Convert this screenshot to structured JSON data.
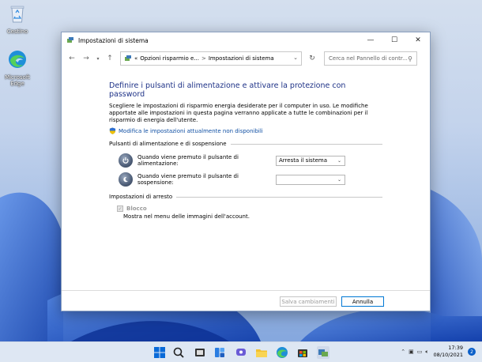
{
  "desktop": {
    "icons": [
      {
        "label": "Cestino"
      },
      {
        "label": "Microsoft Edge"
      }
    ]
  },
  "window": {
    "title": "Impostazioni di sistema",
    "breadcrumb": {
      "prefix": "«",
      "parent": "Opzioni risparmio e...",
      "separator": ">",
      "current": "Impostazioni di sistema"
    },
    "search_placeholder": "Cerca nel Pannello di contr...",
    "heading": "Definire i pulsanti di alimentazione e attivare la protezione con password",
    "description": "Scegliere le impostazioni di risparmio energia desiderate per il computer in uso. Le modifiche apportate alle impostazioni in questa pagina verranno applicate a tutte le combinazioni per il risparmio di energia dell'utente.",
    "change_link": "Modifica le impostazioni attualmente non disponibili",
    "power_group": {
      "title": "Pulsanti di alimentazione e di sospensione",
      "rows": [
        {
          "label": "Quando viene premuto il pulsante di alimentazione:",
          "value": "Arresta il sistema"
        },
        {
          "label": "Quando viene premuto il pulsante di sospensione:",
          "value": ""
        }
      ]
    },
    "shutdown_group": {
      "title": "Impostazioni di arresto",
      "lock_label": "Blocco",
      "lock_desc": "Mostra nel menu delle immagini dell'account."
    },
    "buttons": {
      "save": "Salva cambiamenti",
      "cancel": "Annulla"
    }
  },
  "taskbar": {
    "time": "17:39",
    "date": "08/10/2021",
    "notification_count": "2"
  },
  "colors": {
    "heading": "#1e3287",
    "link": "#0f4fa3",
    "accent": "#0078d4"
  }
}
